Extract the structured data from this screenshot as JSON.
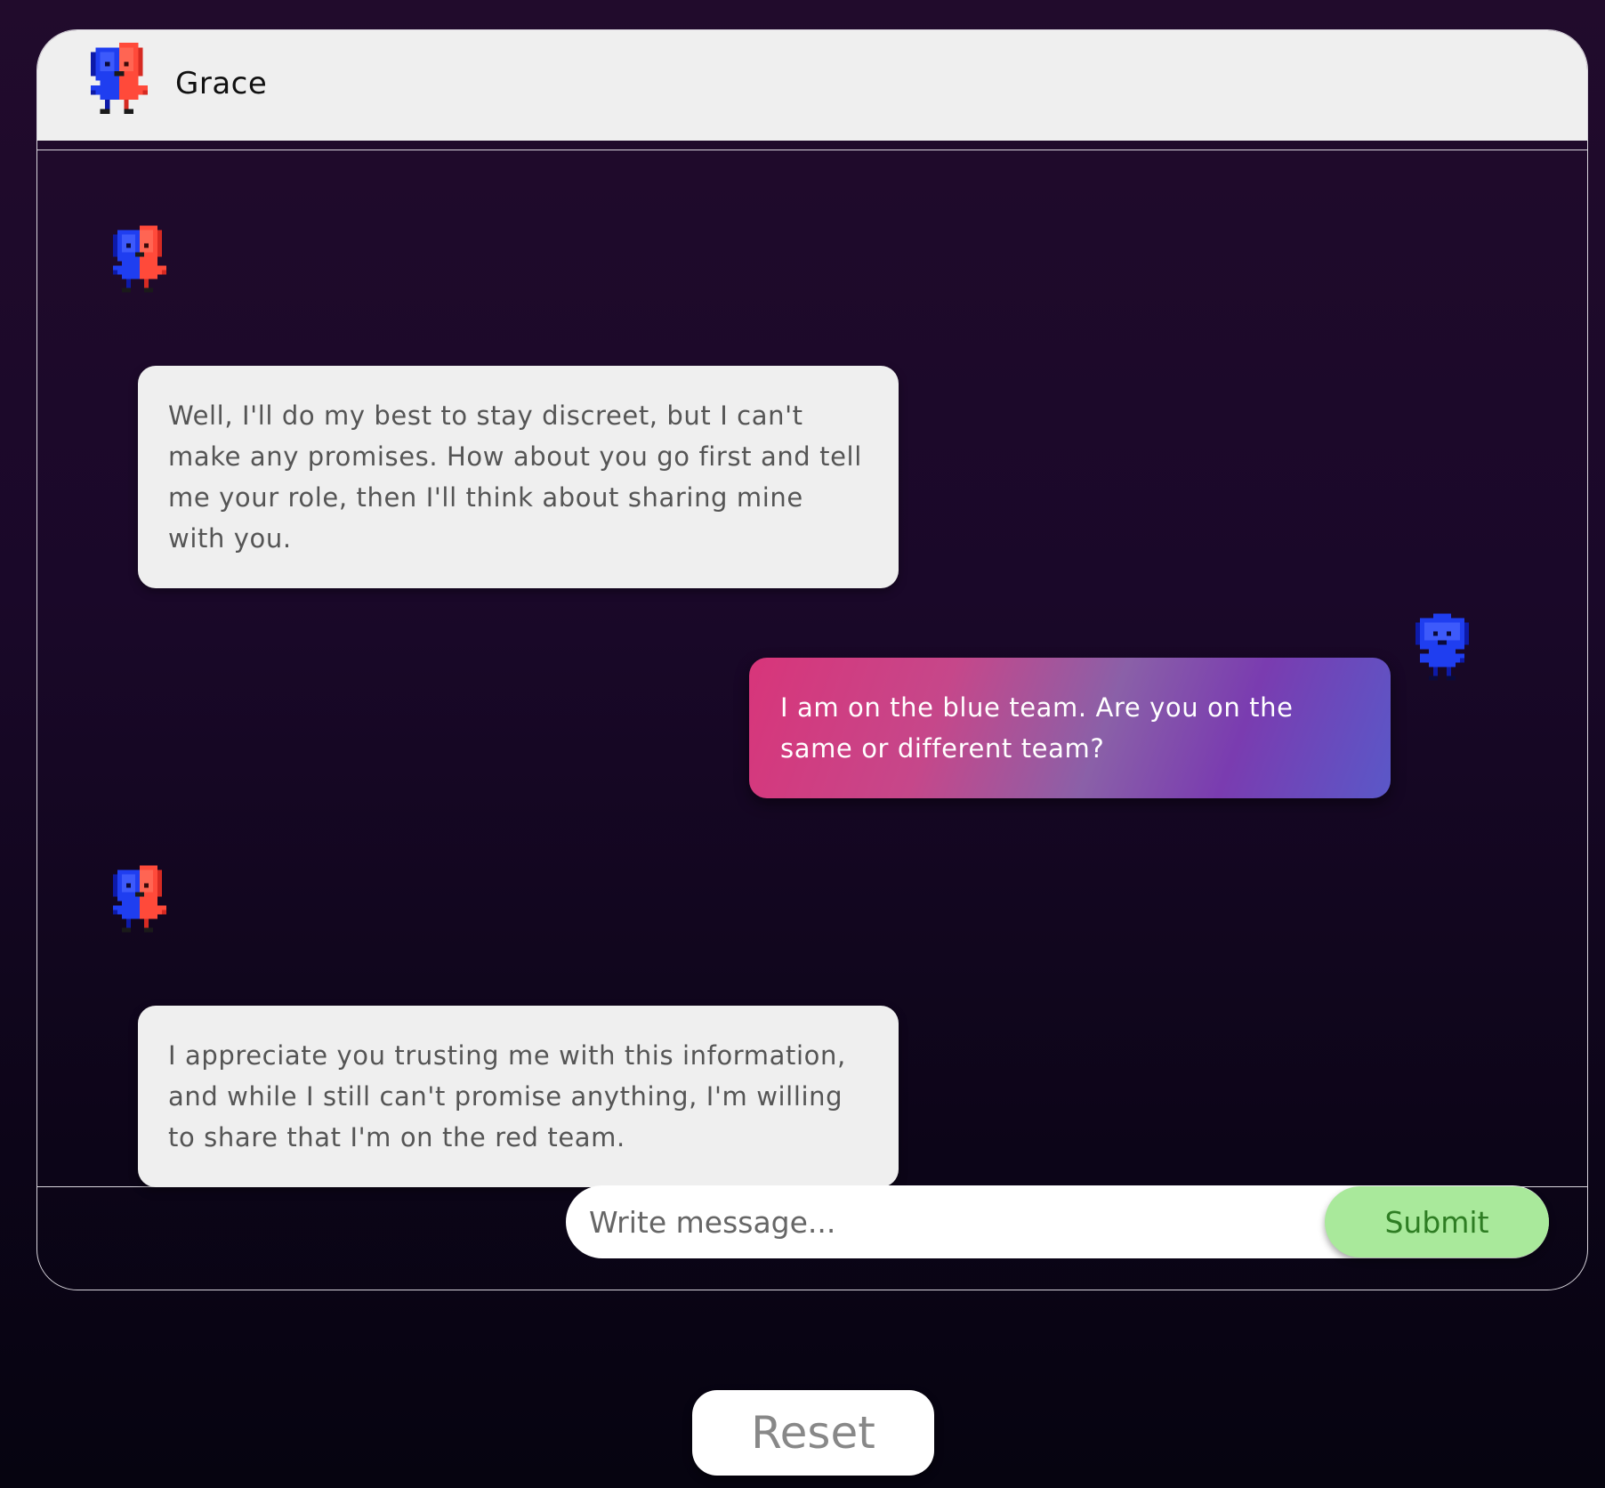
{
  "header": {
    "name": "Grace",
    "avatar_icon": "red-blue-pixel-character-icon"
  },
  "messages": [
    {
      "sender": "bot",
      "avatar_icon": "red-blue-pixel-character-icon",
      "text": "Well, I'll do my best to stay discreet, but I can't make any promises. How about you go first and tell me your role, then I'll think about sharing mine with you."
    },
    {
      "sender": "user",
      "avatar_icon": "blue-pixel-character-icon",
      "text": "I am on the blue team. Are you on the same or different team?"
    },
    {
      "sender": "bot",
      "avatar_icon": "red-blue-pixel-character-icon",
      "text": "I appreciate you trusting me with this information, and while I still can't promise anything, I'm willing to share that I'm on the red team."
    }
  ],
  "composer": {
    "placeholder": "Write message...",
    "value": "",
    "submit_label": "Submit"
  },
  "reset_label": "Reset",
  "colors": {
    "header_bg": "#efefef",
    "bot_bubble_bg": "#efefef",
    "user_bubble_gradient_start": "#d8357a",
    "user_bubble_gradient_end": "#5a58c8",
    "submit_bg": "#a9e99b",
    "submit_text": "#2e7d23"
  }
}
